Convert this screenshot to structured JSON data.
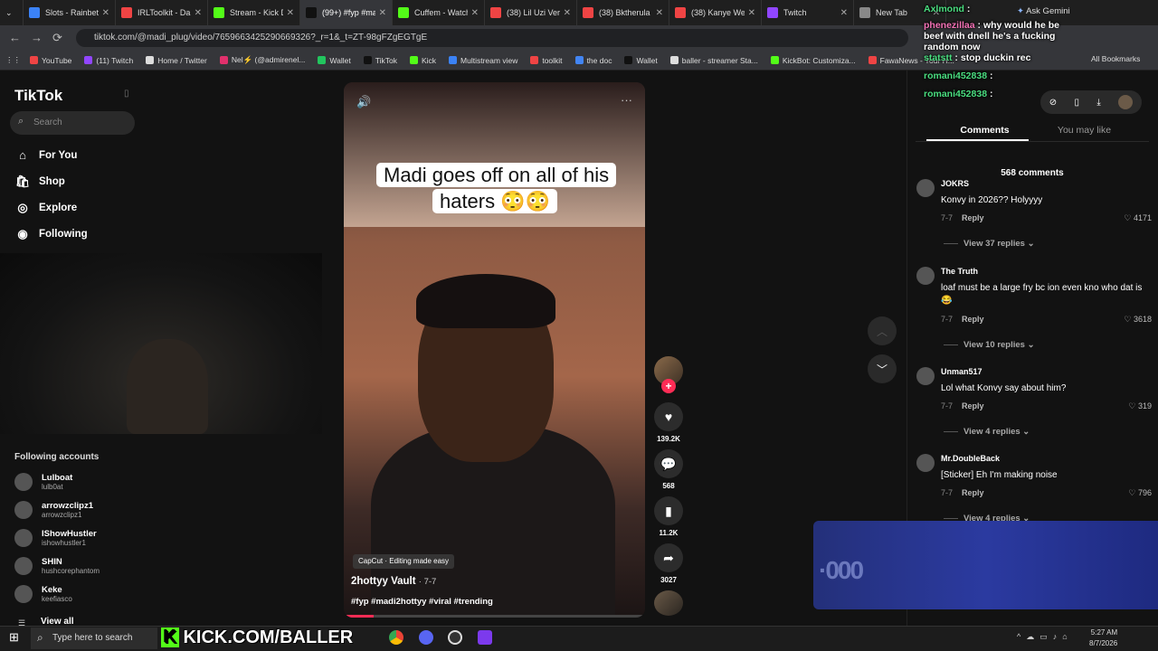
{
  "tabs": [
    {
      "label": "Slots - Rainbet",
      "color": "#3b82f6"
    },
    {
      "label": "IRLToolkit - Da",
      "color": "#ef4444"
    },
    {
      "label": "Stream - Kick D",
      "color": "#53fc18"
    },
    {
      "label": "(99+) #fyp #ma",
      "color": "#111111"
    },
    {
      "label": "Cuffem - Watch",
      "color": "#53fc18"
    },
    {
      "label": "(38) Lil Uzi Vert",
      "color": "#ef4444"
    },
    {
      "label": "(38) Bktherula",
      "color": "#ef4444"
    },
    {
      "label": "(38) Kanye We",
      "color": "#ef4444"
    },
    {
      "label": "Twitch",
      "color": "#9146ff"
    },
    {
      "label": "New Tab",
      "color": "#888888"
    }
  ],
  "address_bar": {
    "url": "tiktok.com/@madi_plug/video/7659663425290669326?_r=1&_t=ZT-98gFZgEGTgE"
  },
  "bookmarks": [
    {
      "label": "YouTube",
      "color": "#ef4444"
    },
    {
      "label": "(11) Twitch",
      "color": "#9146ff"
    },
    {
      "label": "Home / Twitter",
      "color": "#dddddd"
    },
    {
      "label": "Nel⚡ (@admirenel...",
      "color": "#e1306c"
    },
    {
      "label": "Wallet",
      "color": "#22c55e"
    },
    {
      "label": "TikTok",
      "color": "#111111"
    },
    {
      "label": "Kick",
      "color": "#53fc18"
    },
    {
      "label": "Multistream view",
      "color": "#3b82f6"
    },
    {
      "label": "toolkit",
      "color": "#ef4444"
    },
    {
      "label": "the doc",
      "color": "#4285f4"
    },
    {
      "label": "Wallet",
      "color": "#111111"
    },
    {
      "label": "baller - streamer Sta...",
      "color": "#dddddd"
    },
    {
      "label": "KickBot: Customiza...",
      "color": "#53fc18"
    },
    {
      "label": "FawaNews - Your H...",
      "color": "#ef4444"
    }
  ],
  "all_bookmarks": "All Bookmarks",
  "tiktok": {
    "logo": "TikTok",
    "search_placeholder": "Search",
    "nav": [
      "For You",
      "Shop",
      "Explore",
      "Following"
    ],
    "following_header": "Following accounts",
    "following": [
      {
        "name": "Lulboat",
        "handle": "lulb0at"
      },
      {
        "name": "arrowzclipz1",
        "handle": "arrowzclipz1"
      },
      {
        "name": "IShowHustler",
        "handle": "ishowhustler1"
      },
      {
        "name": "SHIN",
        "handle": "hushcorephantom"
      },
      {
        "name": "Keke",
        "handle": "keefiasco"
      }
    ],
    "view_all": "View all"
  },
  "video": {
    "caption": "Madi goes off on all of his haters 😳😳",
    "capcut": "CapCut · Editing made easy",
    "author": "2hottyy Vault",
    "date": "· 7-7",
    "hashtags": "#fyp #madi2hottyy #viral #trending",
    "progress": 0.1,
    "likes": "139.2K",
    "comments": "568",
    "saves": "11.2K",
    "shares": "3027"
  },
  "panel": {
    "tab_comments": "Comments",
    "tab_like": "You may like",
    "count": "568 comments",
    "reply_label": "Reply",
    "comments": [
      {
        "user": "JOKRS",
        "text": "Konvy in 2026?? Holyyyy",
        "date": "7-7",
        "likes": "4171",
        "replies": "View 37 replies"
      },
      {
        "user": "The Truth",
        "text": "loaf must be a large fry bc ion even kno who dat is😂",
        "date": "7-7",
        "likes": "3618",
        "replies": "View 10 replies"
      },
      {
        "user": "Unman517",
        "text": "Lol what Konvy say about him?",
        "date": "7-7",
        "likes": "319",
        "replies": "View 4 replies"
      },
      {
        "user": "Mr.DoubleBack",
        "text": "[Sticker] Eh I'm making noise",
        "date": "7-7",
        "likes": "796",
        "replies": "View 4 replies"
      }
    ]
  },
  "chat": [
    {
      "user": "Axlmond",
      "msg": ""
    },
    {
      "user": "phenezillaa",
      "msg": "why would he be beef with dnell he's a fucking random now"
    },
    {
      "user": "statstt",
      "msg": "stop duckin rec"
    },
    {
      "user": "romani452838",
      "msg": ""
    },
    {
      "user": "romani452838",
      "msg": ""
    }
  ],
  "gemini": "Ask Gemini",
  "blur_text": "·000",
  "taskbar": {
    "search_placeholder": "Type here to search",
    "banner": "KICK.COM/BALLER",
    "banner_k": "K",
    "time": "5:27 AM",
    "date": "8/7/2026"
  }
}
